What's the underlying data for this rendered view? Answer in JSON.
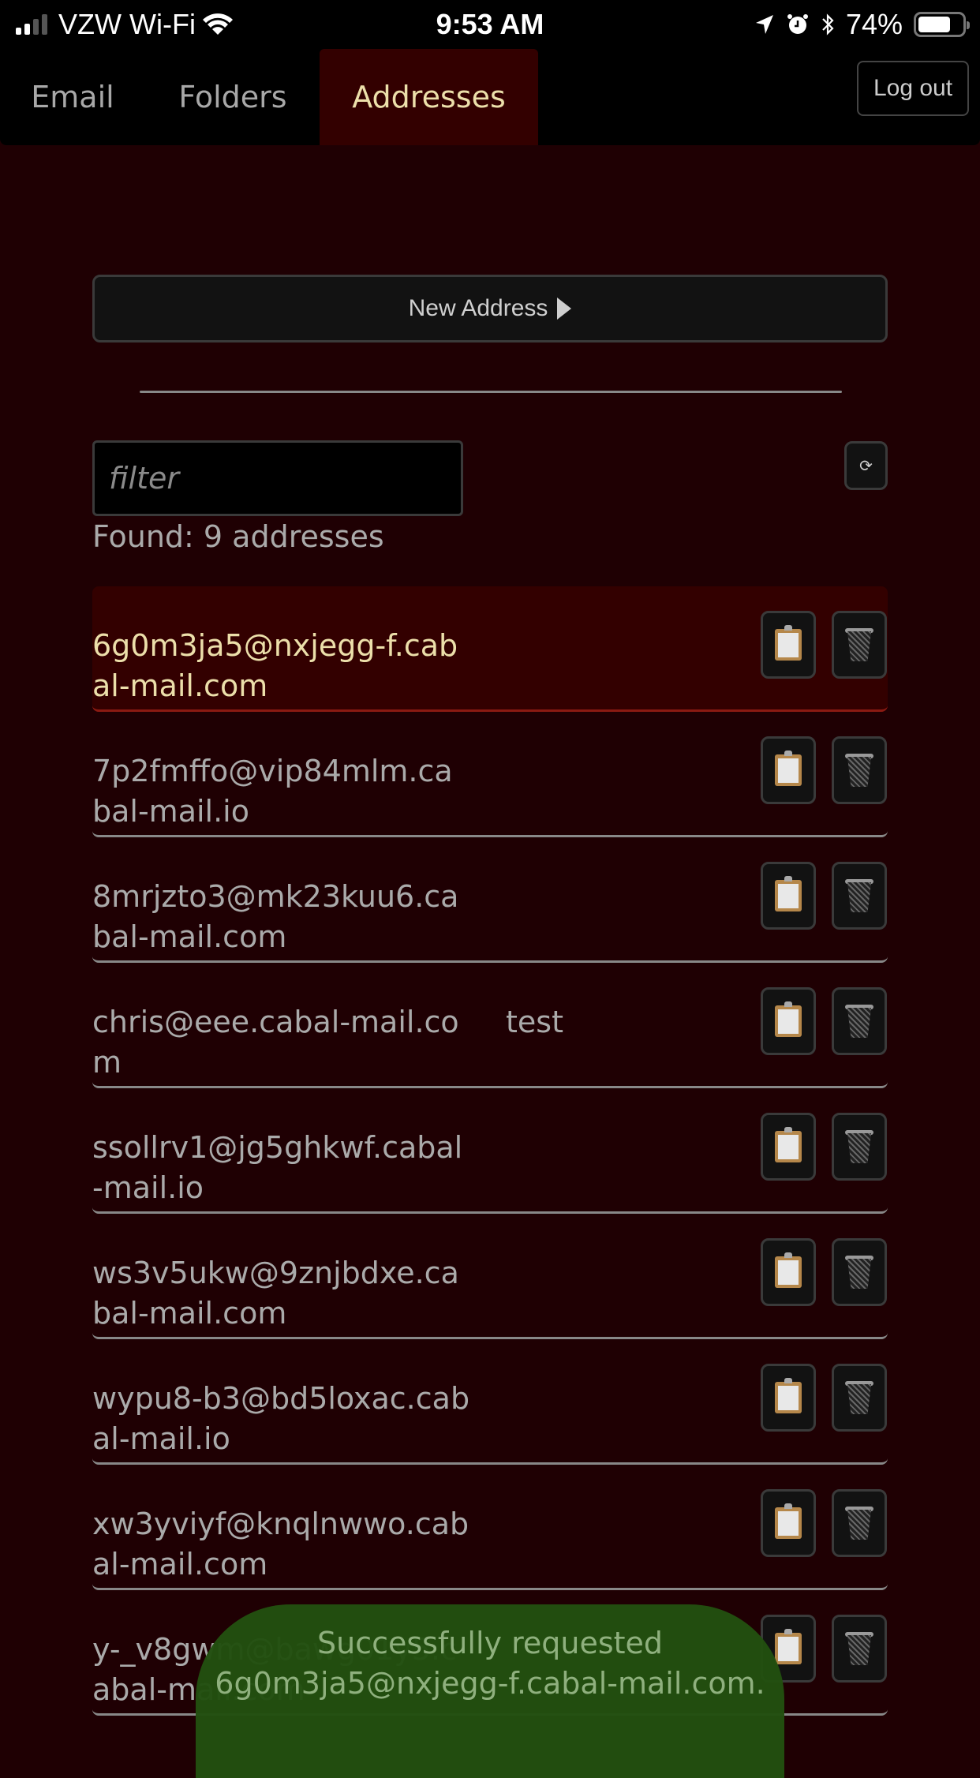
{
  "statusbar": {
    "carrier": "VZW Wi-Fi",
    "time": "9:53 AM",
    "battery": "74%",
    "battery_level": 0.74,
    "icons": [
      "signal-icon",
      "wifi-icon",
      "location-icon",
      "alarm-icon",
      "bluetooth-icon",
      "battery-icon"
    ]
  },
  "nav": {
    "tabs": [
      {
        "label": "Email",
        "active": false
      },
      {
        "label": "Folders",
        "active": false
      },
      {
        "label": "Addresses",
        "active": true
      }
    ],
    "logout_label": "Log out"
  },
  "addresses_page": {
    "new_address_label": "New Address",
    "filter_placeholder": "filter",
    "filter_value": "",
    "refresh_icon": "⟳",
    "found_text": "Found: 9 addresses",
    "items": [
      {
        "address": "6g0m3ja5@nxjegg-f.cabal-mail.com",
        "label": "",
        "active": true
      },
      {
        "address": "7p2fmffo@vip84mlm.cabal-mail.io",
        "label": "",
        "active": false
      },
      {
        "address": "8mrjzto3@mk23kuu6.cabal-mail.com",
        "label": "",
        "active": false
      },
      {
        "address": "chris@eee.cabal-mail.com",
        "label": "test",
        "active": false
      },
      {
        "address": "ssollrv1@jg5ghkwf.cabal-mail.io",
        "label": "",
        "active": false
      },
      {
        "address": "ws3v5ukw@9znjbdxe.cabal-mail.com",
        "label": "",
        "active": false
      },
      {
        "address": "wypu8-b3@bd5loxac.cabal-mail.io",
        "label": "",
        "active": false
      },
      {
        "address": "xw3yviyf@knqlnwwo.cabal-mail.com",
        "label": "",
        "active": false
      },
      {
        "address": "y-_v8gwm@bawg01y5.cabal-mail.com",
        "label": "",
        "active": false
      }
    ]
  },
  "toast": {
    "message": "Successfully requested 6g0m3ja5@nxjegg-f.cabal-mail.com.",
    "color": "#225010"
  },
  "colors": {
    "background": "#1f0003",
    "active_tab": "#330000",
    "active_text": "#ecdfaa",
    "active_underline": "#8b1a12"
  }
}
